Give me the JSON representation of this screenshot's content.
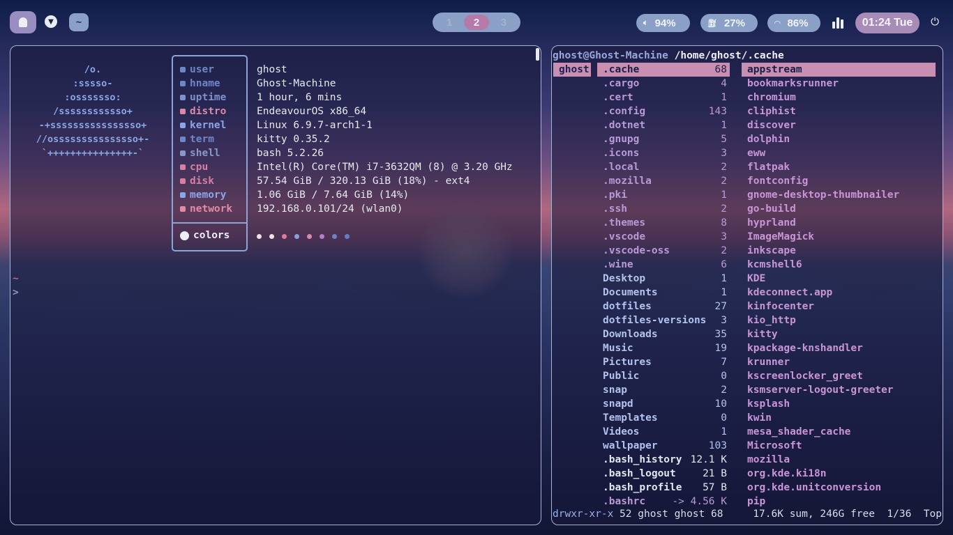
{
  "topbar": {
    "launcher_icon": "ghost-icon",
    "dropdown_icon": "chevron-down-icon",
    "tilde_label": "~",
    "workspaces": [
      "1",
      "2",
      "3"
    ],
    "active_workspace": "2",
    "volume": "94%",
    "battery": "27%",
    "wifi": "86%",
    "clock": "01:24 Tue",
    "colors": {
      "pill": "#8aa0c6",
      "active": "#b57aa8",
      "clock": "#a88cb8"
    }
  },
  "fetch": {
    "logo": [
      "/o.",
      ":sssso-",
      ":osssssso:",
      "/ssssssssssso+",
      "-+ssssssssssssssso+",
      "//osssssssssssssso+-",
      "`+++++++++++++++-`"
    ],
    "keys": [
      {
        "label": "user",
        "color": "#6f86c6"
      },
      {
        "label": "hname",
        "color": "#6f86c6"
      },
      {
        "label": "uptime",
        "color": "#8090c8"
      },
      {
        "label": "distro",
        "color": "#d98aa8"
      },
      {
        "label": "kernel",
        "color": "#8aa6e6"
      },
      {
        "label": "term",
        "color": "#6f86c6"
      },
      {
        "label": "shell",
        "color": "#8a97c8"
      },
      {
        "label": "cpu",
        "color": "#d57fa6"
      },
      {
        "label": "disk",
        "color": "#d57fa6"
      },
      {
        "label": "memory",
        "color": "#8aa6e6"
      },
      {
        "label": "network",
        "color": "#e48aa8"
      }
    ],
    "values": [
      "ghost",
      "Ghost-Machine",
      "1 hour, 6 mins",
      "EndeavourOS x86_64",
      "Linux 6.9.7-arch1-1",
      "kitty 0.35.2",
      "bash 5.2.26",
      "Intel(R) Core(TM) i7-3632QM (8) @ 3.20 GHz",
      "57.54 GiB / 320.13 GiB (18%) - ext4",
      "1.06 GiB / 7.64 GiB (14%)",
      "192.168.0.101/24 (wlan0)"
    ],
    "colors_label": "colors",
    "palette": [
      "#f0e0ea",
      "#f0e0ea",
      "#e07aa0",
      "#8aa0d8",
      "#d98ab0",
      "#b080c8",
      "#7080c0",
      "#6080c8"
    ],
    "prompt_tilde": "~",
    "prompt_arrow": ">"
  },
  "files": {
    "path_user": "ghost@Ghost-Machine",
    "path_dir": "/home/ghost/.cache",
    "parent": "ghost",
    "middle": [
      {
        "name": ".cache",
        "size": "68",
        "kind": "sel"
      },
      {
        "name": ".cargo",
        "size": "4",
        "kind": "hid"
      },
      {
        "name": ".cert",
        "size": "1",
        "kind": "hid"
      },
      {
        "name": ".config",
        "size": "143",
        "kind": "hid"
      },
      {
        "name": ".dotnet",
        "size": "1",
        "kind": "hid"
      },
      {
        "name": ".gnupg",
        "size": "5",
        "kind": "hid"
      },
      {
        "name": ".icons",
        "size": "3",
        "kind": "hid"
      },
      {
        "name": ".local",
        "size": "2",
        "kind": "hid"
      },
      {
        "name": ".mozilla",
        "size": "2",
        "kind": "hid"
      },
      {
        "name": ".pki",
        "size": "1",
        "kind": "hid"
      },
      {
        "name": ".ssh",
        "size": "2",
        "kind": "hid"
      },
      {
        "name": ".themes",
        "size": "8",
        "kind": "hid"
      },
      {
        "name": ".vscode",
        "size": "3",
        "kind": "hid"
      },
      {
        "name": ".vscode-oss",
        "size": "2",
        "kind": "hid"
      },
      {
        "name": ".wine",
        "size": "6",
        "kind": "hid"
      },
      {
        "name": "Desktop",
        "size": "1",
        "kind": "dirc"
      },
      {
        "name": "Documents",
        "size": "1",
        "kind": "dirc"
      },
      {
        "name": "dotfiles",
        "size": "27",
        "kind": "dirc"
      },
      {
        "name": "dotfiles-versions",
        "size": "3",
        "kind": "dirc"
      },
      {
        "name": "Downloads",
        "size": "35",
        "kind": "dirc"
      },
      {
        "name": "Music",
        "size": "19",
        "kind": "dirc"
      },
      {
        "name": "Pictures",
        "size": "7",
        "kind": "dirc"
      },
      {
        "name": "Public",
        "size": "0",
        "kind": "dirc"
      },
      {
        "name": "snap",
        "size": "2",
        "kind": "dirc"
      },
      {
        "name": "snapd",
        "size": "10",
        "kind": "dirc"
      },
      {
        "name": "Templates",
        "size": "0",
        "kind": "dirc"
      },
      {
        "name": "Videos",
        "size": "1",
        "kind": "dirc"
      },
      {
        "name": "wallpaper",
        "size": "103",
        "kind": "dirc"
      },
      {
        "name": ".bash_history",
        "size": "12.1 K",
        "kind": "file"
      },
      {
        "name": ".bash_logout",
        "size": "21 B",
        "kind": "file"
      },
      {
        "name": ".bash_profile",
        "size": "57 B",
        "kind": "file"
      },
      {
        "name": ".bashrc",
        "size": "-> 4.56 K",
        "kind": "hid"
      }
    ],
    "right": [
      "appstream",
      "bookmarksrunner",
      "chromium",
      "cliphist",
      "discover",
      "dolphin",
      "eww",
      "flatpak",
      "fontconfig",
      "gnome-desktop-thumbnailer",
      "go-build",
      "hyprland",
      "ImageMagick",
      "inkscape",
      "kcmshell6",
      "KDE",
      "kdeconnect.app",
      "kinfocenter",
      "kio_http",
      "kitty",
      "kpackage-knshandler",
      "krunner",
      "kscreenlocker_greet",
      "ksmserver-logout-greeter",
      "ksplash",
      "kwin",
      "mesa_shader_cache",
      "Microsoft",
      "mozilla",
      "org.kde.ki18n",
      "org.kde.unitconversion",
      "pip"
    ],
    "status_perm": "drwxr-xr-x",
    "status_info": "52 ghost ghost 68",
    "status_sum": "17.6K sum, 246G free",
    "status_pos": "1/36",
    "status_top": "Top"
  }
}
